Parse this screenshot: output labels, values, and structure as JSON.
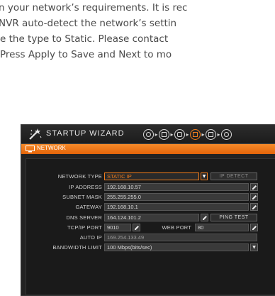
{
  "intro": {
    "lines": [
      "n your network’s requirements. It is rec",
      " NVR auto-detect the network’s settin",
      "e the type to Static. Please contact",
      " Press Apply to Save and Next to mo"
    ]
  },
  "wizard": {
    "title": "STARTUP WIZARD",
    "section_title": "NETWORK",
    "steps": [
      "wizard-step-1",
      "wizard-step-2",
      "wizard-step-3",
      "wizard-step-4",
      "wizard-step-5",
      "wizard-step-6"
    ],
    "active_step_index": 3,
    "accent_color": "#f07c1c"
  },
  "network": {
    "network_type_label": "NETWORK TYPE",
    "network_type_value": "STATIC IP",
    "ip_detect_label": "IP DETECT",
    "ip_address_label": "IP ADDRESS",
    "ip_address_value": "192.168.10.57",
    "subnet_mask_label": "SUBNET MASK",
    "subnet_mask_value": "255.255.255.0",
    "gateway_label": "GATEWAY",
    "gateway_value": "192.168.10.1",
    "dns_server_label": "DNS SERVER",
    "dns_server_value": "164.124.101.2",
    "ping_test_label": "PING TEST",
    "tcp_port_label": "TCP/IP PORT",
    "tcp_port_value": "9010",
    "web_port_label": "WEB PORT",
    "web_port_value": "80",
    "auto_ip_label": "AUTO IP",
    "auto_ip_value": "169.254.133.49",
    "bandwidth_label": "BANDWIDTH LIMIT",
    "bandwidth_value": "100 Mbps(bits/sec)"
  }
}
